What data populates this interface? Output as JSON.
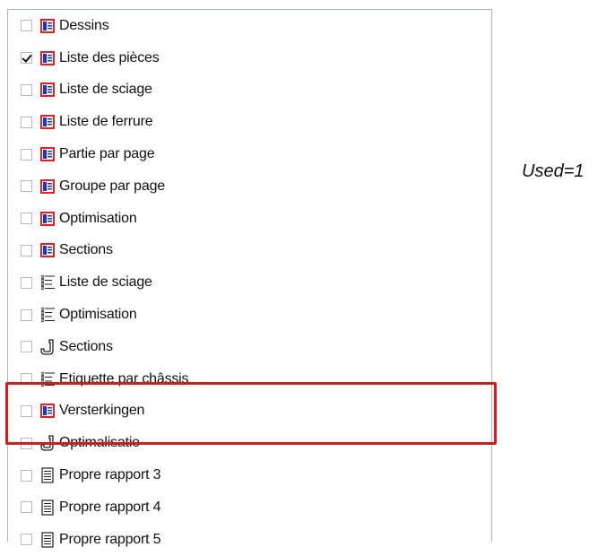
{
  "list": {
    "items": [
      {
        "label": "Dessins",
        "checked": false,
        "icon": "report-icon"
      },
      {
        "label": "Liste des pièces",
        "checked": true,
        "icon": "report-icon"
      },
      {
        "label": "Liste de sciage",
        "checked": false,
        "icon": "report-icon"
      },
      {
        "label": "Liste de ferrure",
        "checked": false,
        "icon": "report-icon"
      },
      {
        "label": "Partie par page",
        "checked": false,
        "icon": "report-icon"
      },
      {
        "label": "Groupe par page",
        "checked": false,
        "icon": "report-icon"
      },
      {
        "label": "Optimisation",
        "checked": false,
        "icon": "report-icon"
      },
      {
        "label": "Sections",
        "checked": false,
        "icon": "report-icon"
      },
      {
        "label": "Liste de sciage",
        "checked": false,
        "icon": "list-tree-icon"
      },
      {
        "label": "Optimisation",
        "checked": false,
        "icon": "list-tree-icon"
      },
      {
        "label": "Sections",
        "checked": false,
        "icon": "section-profile-icon"
      },
      {
        "label": "Etiquette par châssis",
        "checked": false,
        "icon": "list-tree-icon"
      },
      {
        "label": "Versterkingen",
        "checked": false,
        "icon": "report-icon"
      },
      {
        "label": "Optimalisatie",
        "checked": false,
        "icon": "section-profile-icon"
      },
      {
        "label": "Propre rapport 3",
        "checked": false,
        "icon": "document-lines-icon"
      },
      {
        "label": "Propre rapport 4",
        "checked": false,
        "icon": "document-lines-icon"
      },
      {
        "label": "Propre rapport 5",
        "checked": false,
        "icon": "document-lines-icon"
      }
    ]
  },
  "note": {
    "text": "Used=1"
  },
  "colors": {
    "highlight": "#d01c1c",
    "icon_red": "#d8232a",
    "icon_blue": "#1f3aa8"
  }
}
